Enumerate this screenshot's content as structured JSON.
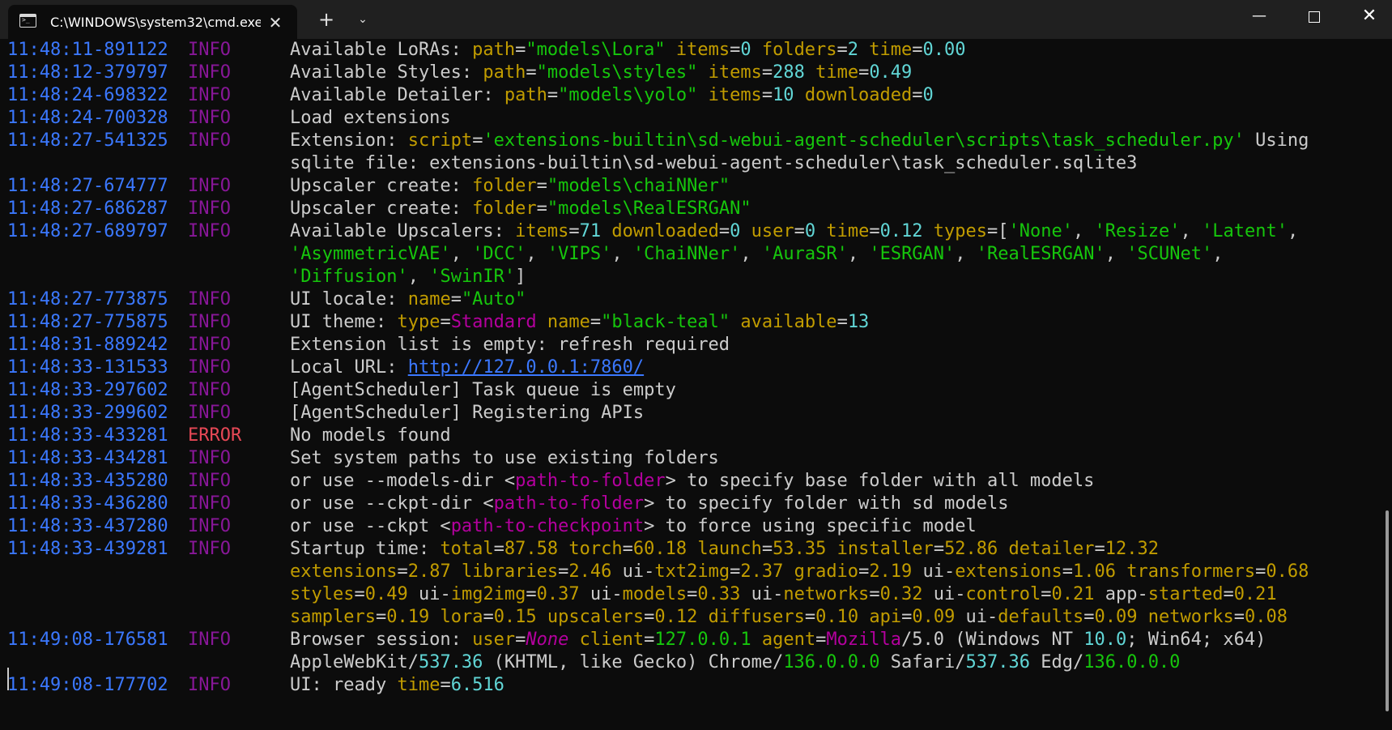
{
  "window": {
    "tab_title": "C:\\WINDOWS\\system32\\cmd.exe",
    "tab_icon": "terminal-icon",
    "close_tab_glyph": "✕",
    "new_tab_glyph": "+",
    "dropdown_glyph": "⌄",
    "minimize_glyph": "—",
    "close_glyph": "✕"
  },
  "colors": {
    "background": "#0c0c0c",
    "timestamp": "#3b78ff",
    "info": "#881798",
    "error": "#e74856",
    "text": "#cccccc",
    "key": "#c19c00",
    "string": "#16c60c",
    "number": "#61d6d6",
    "magenta": "#b4009e"
  },
  "lines": [
    {
      "ts": "11:48:11-891122",
      "level": "INFO",
      "segs": [
        [
          "t",
          "Available LoRAs: "
        ],
        [
          "k",
          "path"
        ],
        [
          "t",
          "="
        ],
        [
          "s",
          "\"models\\Lora\""
        ],
        [
          "t",
          " "
        ],
        [
          "k",
          "items"
        ],
        [
          "t",
          "="
        ],
        [
          "n",
          "0"
        ],
        [
          "t",
          " "
        ],
        [
          "k",
          "folders"
        ],
        [
          "t",
          "="
        ],
        [
          "n",
          "2"
        ],
        [
          "t",
          " "
        ],
        [
          "k",
          "time"
        ],
        [
          "t",
          "="
        ],
        [
          "n",
          "0.00"
        ]
      ]
    },
    {
      "ts": "11:48:12-379797",
      "level": "INFO",
      "segs": [
        [
          "t",
          "Available Styles: "
        ],
        [
          "k",
          "path"
        ],
        [
          "t",
          "="
        ],
        [
          "s",
          "\"models\\styles\""
        ],
        [
          "t",
          " "
        ],
        [
          "k",
          "items"
        ],
        [
          "t",
          "="
        ],
        [
          "n",
          "288"
        ],
        [
          "t",
          " "
        ],
        [
          "k",
          "time"
        ],
        [
          "t",
          "="
        ],
        [
          "n",
          "0.49"
        ]
      ]
    },
    {
      "ts": "11:48:24-698322",
      "level": "INFO",
      "segs": [
        [
          "t",
          "Available Detailer: "
        ],
        [
          "k",
          "path"
        ],
        [
          "t",
          "="
        ],
        [
          "s",
          "\"models\\yolo\""
        ],
        [
          "t",
          " "
        ],
        [
          "k",
          "items"
        ],
        [
          "t",
          "="
        ],
        [
          "n",
          "10"
        ],
        [
          "t",
          " "
        ],
        [
          "k",
          "downloaded"
        ],
        [
          "t",
          "="
        ],
        [
          "n",
          "0"
        ]
      ]
    },
    {
      "ts": "11:48:24-700328",
      "level": "INFO",
      "segs": [
        [
          "t",
          "Load extensions"
        ]
      ]
    },
    {
      "ts": "11:48:27-541325",
      "level": "INFO",
      "segs": [
        [
          "t",
          "Extension: "
        ],
        [
          "k",
          "script"
        ],
        [
          "t",
          "="
        ],
        [
          "s",
          "'extensions-builtin\\sd-webui-agent-scheduler\\scripts\\task_scheduler.py'"
        ],
        [
          "t",
          " Using"
        ]
      ]
    },
    {
      "ts": "",
      "level": "",
      "segs": [
        [
          "t",
          "sqlite file: extensions-builtin\\sd-webui-agent-scheduler\\task_scheduler.sqlite3"
        ]
      ]
    },
    {
      "ts": "11:48:27-674777",
      "level": "INFO",
      "segs": [
        [
          "t",
          "Upscaler create: "
        ],
        [
          "k",
          "folder"
        ],
        [
          "t",
          "="
        ],
        [
          "s",
          "\"models\\chaiNNer\""
        ]
      ]
    },
    {
      "ts": "11:48:27-686287",
      "level": "INFO",
      "segs": [
        [
          "t",
          "Upscaler create: "
        ],
        [
          "k",
          "folder"
        ],
        [
          "t",
          "="
        ],
        [
          "s",
          "\"models\\RealESRGAN\""
        ]
      ]
    },
    {
      "ts": "11:48:27-689797",
      "level": "INFO",
      "segs": [
        [
          "t",
          "Available Upscalers: "
        ],
        [
          "k",
          "items"
        ],
        [
          "t",
          "="
        ],
        [
          "n",
          "71"
        ],
        [
          "t",
          " "
        ],
        [
          "k",
          "downloaded"
        ],
        [
          "t",
          "="
        ],
        [
          "n",
          "0"
        ],
        [
          "t",
          " "
        ],
        [
          "k",
          "user"
        ],
        [
          "t",
          "="
        ],
        [
          "n",
          "0"
        ],
        [
          "t",
          " "
        ],
        [
          "k",
          "time"
        ],
        [
          "t",
          "="
        ],
        [
          "n",
          "0.12"
        ],
        [
          "t",
          " "
        ],
        [
          "k",
          "types"
        ],
        [
          "t",
          "=["
        ],
        [
          "s",
          "'None'"
        ],
        [
          "t",
          ", "
        ],
        [
          "s",
          "'Resize'"
        ],
        [
          "t",
          ", "
        ],
        [
          "s",
          "'Latent'"
        ],
        [
          "t",
          ","
        ]
      ]
    },
    {
      "ts": "",
      "level": "",
      "segs": [
        [
          "s",
          "'AsymmetricVAE'"
        ],
        [
          "t",
          ", "
        ],
        [
          "s",
          "'DCC'"
        ],
        [
          "t",
          ", "
        ],
        [
          "s",
          "'VIPS'"
        ],
        [
          "t",
          ", "
        ],
        [
          "s",
          "'ChaiNNer'"
        ],
        [
          "t",
          ", "
        ],
        [
          "s",
          "'AuraSR'"
        ],
        [
          "t",
          ", "
        ],
        [
          "s",
          "'ESRGAN'"
        ],
        [
          "t",
          ", "
        ],
        [
          "s",
          "'RealESRGAN'"
        ],
        [
          "t",
          ", "
        ],
        [
          "s",
          "'SCUNet'"
        ],
        [
          "t",
          ","
        ]
      ]
    },
    {
      "ts": "",
      "level": "",
      "segs": [
        [
          "s",
          "'Diffusion'"
        ],
        [
          "t",
          ", "
        ],
        [
          "s",
          "'SwinIR'"
        ],
        [
          "t",
          "]"
        ]
      ]
    },
    {
      "ts": "11:48:27-773875",
      "level": "INFO",
      "segs": [
        [
          "t",
          "UI locale: "
        ],
        [
          "k",
          "name"
        ],
        [
          "t",
          "="
        ],
        [
          "s",
          "\"Auto\""
        ]
      ]
    },
    {
      "ts": "11:48:27-775875",
      "level": "INFO",
      "segs": [
        [
          "t",
          "UI theme: "
        ],
        [
          "k",
          "type"
        ],
        [
          "t",
          "="
        ],
        [
          "m",
          "Standard"
        ],
        [
          "t",
          " "
        ],
        [
          "k",
          "name"
        ],
        [
          "t",
          "="
        ],
        [
          "s",
          "\"black-teal\""
        ],
        [
          "t",
          " "
        ],
        [
          "k",
          "available"
        ],
        [
          "t",
          "="
        ],
        [
          "n",
          "13"
        ]
      ]
    },
    {
      "ts": "11:48:31-889242",
      "level": "INFO",
      "segs": [
        [
          "t",
          "Extension list is empty: refresh required"
        ]
      ]
    },
    {
      "ts": "11:48:33-131533",
      "level": "INFO",
      "segs": [
        [
          "t",
          "Local URL: "
        ],
        [
          "link",
          "http://127.0.0.1:7860/"
        ]
      ]
    },
    {
      "ts": "11:48:33-297602",
      "level": "INFO",
      "segs": [
        [
          "t",
          "[AgentScheduler] Task queue is empty"
        ]
      ]
    },
    {
      "ts": "11:48:33-299602",
      "level": "INFO",
      "segs": [
        [
          "t",
          "[AgentScheduler] Registering APIs"
        ]
      ]
    },
    {
      "ts": "11:48:33-433281",
      "level": "ERROR",
      "segs": [
        [
          "t",
          "No models found"
        ]
      ]
    },
    {
      "ts": "11:48:33-434281",
      "level": "INFO",
      "segs": [
        [
          "t",
          "Set system paths to use existing folders"
        ]
      ]
    },
    {
      "ts": "11:48:33-435280",
      "level": "INFO",
      "segs": [
        [
          "t",
          "  or use --models-dir <"
        ],
        [
          "m",
          "path-to-folder"
        ],
        [
          "t",
          "> to specify base folder with all models"
        ]
      ]
    },
    {
      "ts": "11:48:33-436280",
      "level": "INFO",
      "segs": [
        [
          "t",
          "  or use --ckpt-dir <"
        ],
        [
          "m",
          "path-to-folder"
        ],
        [
          "t",
          "> to specify folder with sd models"
        ]
      ]
    },
    {
      "ts": "11:48:33-437280",
      "level": "INFO",
      "segs": [
        [
          "t",
          "  or use --ckpt <"
        ],
        [
          "m",
          "path-to-checkpoint"
        ],
        [
          "t",
          "> to force using specific model"
        ]
      ]
    },
    {
      "ts": "11:48:33-439281",
      "level": "INFO",
      "segs": [
        [
          "t",
          "Startup time: "
        ],
        [
          "k",
          "total"
        ],
        [
          "t",
          "="
        ],
        [
          "y",
          "87.58"
        ],
        [
          "t",
          " "
        ],
        [
          "k",
          "torch"
        ],
        [
          "t",
          "="
        ],
        [
          "y",
          "60.18"
        ],
        [
          "t",
          " "
        ],
        [
          "k",
          "launch"
        ],
        [
          "t",
          "="
        ],
        [
          "y",
          "53.35"
        ],
        [
          "t",
          " "
        ],
        [
          "k",
          "installer"
        ],
        [
          "t",
          "="
        ],
        [
          "y",
          "52.86"
        ],
        [
          "t",
          " "
        ],
        [
          "k",
          "detailer"
        ],
        [
          "t",
          "="
        ],
        [
          "y",
          "12.32"
        ]
      ]
    },
    {
      "ts": "",
      "level": "",
      "segs": [
        [
          "k",
          "extensions"
        ],
        [
          "t",
          "="
        ],
        [
          "y",
          "2.87"
        ],
        [
          "t",
          " "
        ],
        [
          "k",
          "libraries"
        ],
        [
          "t",
          "="
        ],
        [
          "y",
          "2.46"
        ],
        [
          "t",
          " ui-"
        ],
        [
          "k",
          "txt2img"
        ],
        [
          "t",
          "="
        ],
        [
          "y",
          "2.37"
        ],
        [
          "t",
          " "
        ],
        [
          "k",
          "gradio"
        ],
        [
          "t",
          "="
        ],
        [
          "y",
          "2.19"
        ],
        [
          "t",
          " ui-"
        ],
        [
          "k",
          "extensions"
        ],
        [
          "t",
          "="
        ],
        [
          "y",
          "1.06"
        ],
        [
          "t",
          " "
        ],
        [
          "k",
          "transformers"
        ],
        [
          "t",
          "="
        ],
        [
          "y",
          "0.68"
        ]
      ]
    },
    {
      "ts": "",
      "level": "",
      "segs": [
        [
          "k",
          "styles"
        ],
        [
          "t",
          "="
        ],
        [
          "y",
          "0.49"
        ],
        [
          "t",
          " ui-"
        ],
        [
          "k",
          "img2img"
        ],
        [
          "t",
          "="
        ],
        [
          "y",
          "0.37"
        ],
        [
          "t",
          " ui-"
        ],
        [
          "k",
          "models"
        ],
        [
          "t",
          "="
        ],
        [
          "y",
          "0.33"
        ],
        [
          "t",
          " ui-"
        ],
        [
          "k",
          "networks"
        ],
        [
          "t",
          "="
        ],
        [
          "y",
          "0.32"
        ],
        [
          "t",
          " ui-"
        ],
        [
          "k",
          "control"
        ],
        [
          "t",
          "="
        ],
        [
          "y",
          "0.21"
        ],
        [
          "t",
          " app-"
        ],
        [
          "k",
          "started"
        ],
        [
          "t",
          "="
        ],
        [
          "y",
          "0.21"
        ]
      ]
    },
    {
      "ts": "",
      "level": "",
      "segs": [
        [
          "k",
          "samplers"
        ],
        [
          "t",
          "="
        ],
        [
          "y",
          "0.19"
        ],
        [
          "t",
          " "
        ],
        [
          "k",
          "lora"
        ],
        [
          "t",
          "="
        ],
        [
          "y",
          "0.15"
        ],
        [
          "t",
          " "
        ],
        [
          "k",
          "upscalers"
        ],
        [
          "t",
          "="
        ],
        [
          "y",
          "0.12"
        ],
        [
          "t",
          " "
        ],
        [
          "k",
          "diffusers"
        ],
        [
          "t",
          "="
        ],
        [
          "y",
          "0.10"
        ],
        [
          "t",
          " "
        ],
        [
          "k",
          "api"
        ],
        [
          "t",
          "="
        ],
        [
          "y",
          "0.09"
        ],
        [
          "t",
          " ui-"
        ],
        [
          "k",
          "defaults"
        ],
        [
          "t",
          "="
        ],
        [
          "y",
          "0.09"
        ],
        [
          "t",
          " "
        ],
        [
          "k",
          "networks"
        ],
        [
          "t",
          "="
        ],
        [
          "y",
          "0.08"
        ]
      ]
    },
    {
      "ts": "11:49:08-176581",
      "level": "INFO",
      "segs": [
        [
          "t",
          "Browser session: "
        ],
        [
          "k",
          "user"
        ],
        [
          "t",
          "="
        ],
        [
          "mi",
          "None"
        ],
        [
          "t",
          " "
        ],
        [
          "k",
          "client"
        ],
        [
          "t",
          "="
        ],
        [
          "s",
          "127.0.0.1"
        ],
        [
          "t",
          " "
        ],
        [
          "k",
          "agent"
        ],
        [
          "t",
          "="
        ],
        [
          "m",
          "Mozilla"
        ],
        [
          "t",
          "/5.0 (Windows NT "
        ],
        [
          "n",
          "10.0"
        ],
        [
          "t",
          "; Win64; x64)"
        ]
      ]
    },
    {
      "ts": "",
      "level": "",
      "segs": [
        [
          "t",
          "AppleWebKit/"
        ],
        [
          "n",
          "537.36"
        ],
        [
          "t",
          " (KHTML, like Gecko) Chrome/"
        ],
        [
          "s",
          "136.0.0.0"
        ],
        [
          "t",
          " Safari/"
        ],
        [
          "n",
          "537.36"
        ],
        [
          "t",
          " Edg/"
        ],
        [
          "s",
          "136.0.0.0"
        ]
      ]
    },
    {
      "ts": "11:49:08-177702",
      "level": "INFO",
      "segs": [
        [
          "t",
          "UI: ready "
        ],
        [
          "k",
          "time"
        ],
        [
          "t",
          "="
        ],
        [
          "n",
          "6.516"
        ]
      ]
    }
  ]
}
